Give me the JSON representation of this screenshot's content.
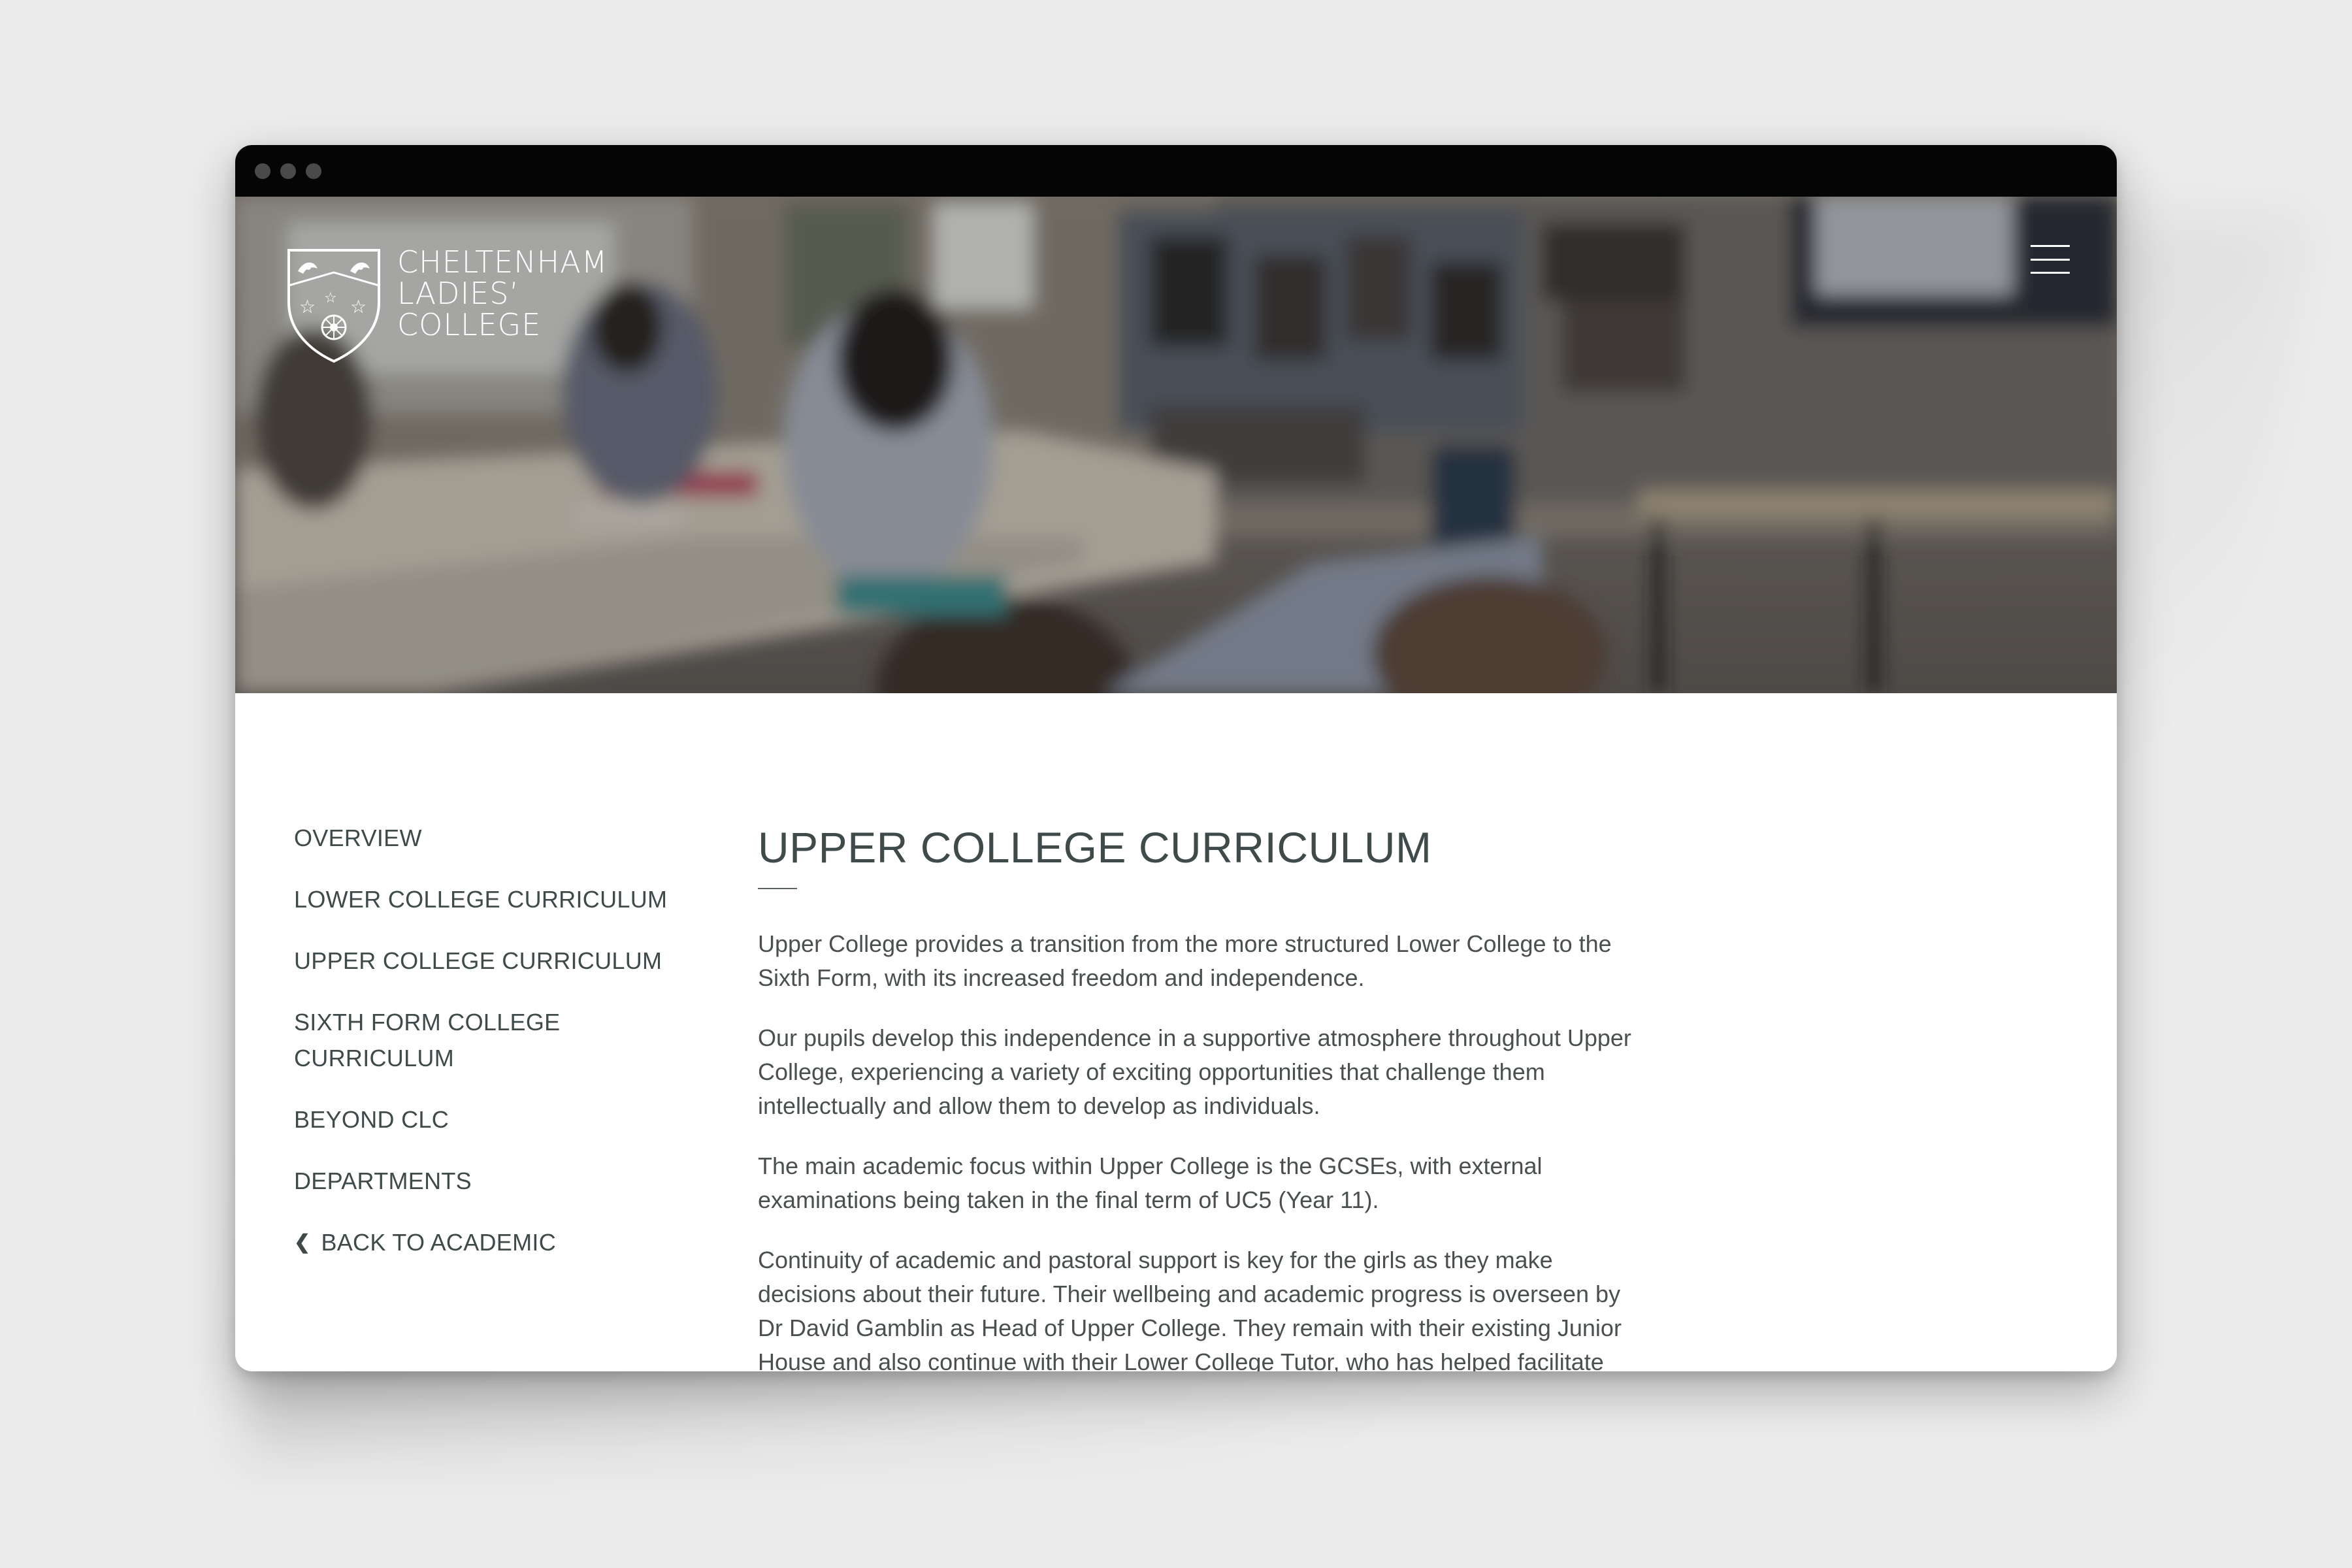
{
  "window": {
    "controls": [
      "close-dot",
      "minimize-dot",
      "maximize-dot"
    ]
  },
  "header": {
    "logo_lines": [
      "CHELTENHAM",
      "LADIES’",
      "COLLEGE"
    ],
    "menu_icon": "hamburger-menu-icon"
  },
  "sidebar": {
    "items": [
      {
        "label": "OVERVIEW"
      },
      {
        "label": "LOWER COLLEGE CURRICULUM"
      },
      {
        "label": "UPPER COLLEGE CURRICULUM"
      },
      {
        "label": "SIXTH FORM COLLEGE CURRICULUM"
      },
      {
        "label": "BEYOND CLC"
      },
      {
        "label": "DEPARTMENTS"
      }
    ],
    "back_label": "BACK TO ACADEMIC",
    "back_icon": "chevron-left-icon"
  },
  "main": {
    "title": "UPPER COLLEGE CURRICULUM",
    "paragraphs": [
      "Upper College provides a transition from the more structured Lower College to the Sixth Form, with its increased freedom and independence.",
      "Our pupils develop this independence in a supportive atmosphere throughout Upper College, experiencing a variety of exciting opportunities that challenge them intellectually and allow them to develop as individuals.",
      "The main academic focus within Upper College is the GCSEs, with external examinations being taken in the final term of UC5 (Year 11).",
      "Continuity of academic and pastoral support is key for the girls as they make decisions about their future. Their wellbeing and academic progress is overseen by Dr David Gamblin as Head of Upper College. They remain with their existing Junior House and also continue with their Lower College Tutor, who has helped facilitate the GCSE"
    ]
  },
  "colors": {
    "text": "#3f4a4a",
    "titlebar": "#050505",
    "background": "#ececec"
  }
}
